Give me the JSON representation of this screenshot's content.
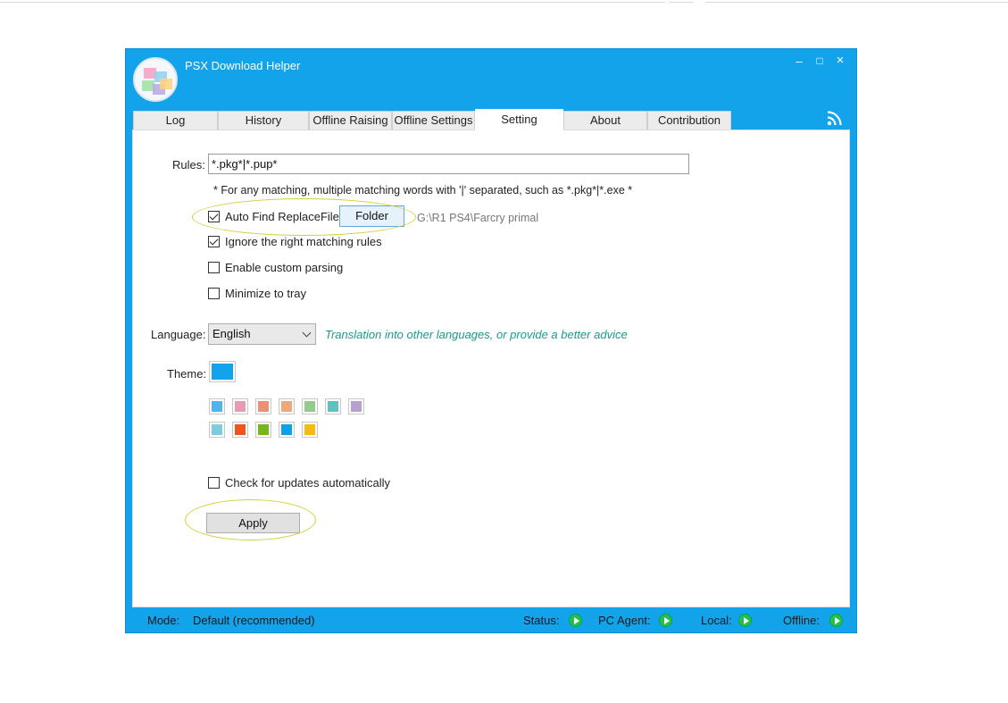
{
  "window": {
    "title": "PSX Download Helper",
    "accent_color": "#12a3eb",
    "controls": {
      "minimize": "–",
      "maximize": "□",
      "close": "×"
    }
  },
  "tabs": [
    {
      "label": "Log"
    },
    {
      "label": "History"
    },
    {
      "label": "Offline Raising"
    },
    {
      "label": "Offline Settings"
    },
    {
      "label": "Setting"
    },
    {
      "label": "About"
    },
    {
      "label": "Contribution"
    }
  ],
  "active_tab": "Setting",
  "icons": {
    "rss": "rss-icon",
    "logo": "app-logo"
  },
  "settings": {
    "rules_label": "Rules:",
    "rules_value": "*.pkg*|*.pup*",
    "rules_note": "* For any matching, multiple matching words with '|' separated, such as *.pkg*|*.exe *",
    "auto_find_label": "Auto Find ReplaceFile",
    "auto_find_checked": true,
    "folder_button": "Folder",
    "folder_path": "G:\\R1 PS4\\Farcry primal",
    "ignore_rules_label": "Ignore the right matching rules",
    "ignore_rules_checked": true,
    "custom_parsing_label": "Enable custom parsing",
    "custom_parsing_checked": false,
    "minimize_tray_label": "Minimize to tray",
    "minimize_tray_checked": false,
    "language_label": "Language:",
    "language_value": "English",
    "translation_link": "Translation into other languages, or provide a better advice",
    "theme_label": "Theme:",
    "theme_current": "#12a3eb",
    "theme_swatches": [
      [
        "#52b4ec",
        "#e89ab6",
        "#ec8f77",
        "#eea97a",
        "#93cb8e",
        "#5cc3bd",
        "#b6a0cf"
      ],
      [
        "#7fcbe0",
        "#f0541e",
        "#76b51c",
        "#10a0e8",
        "#f8b910"
      ]
    ],
    "check_updates_label": "Check for updates automatically",
    "check_updates_checked": false,
    "apply_button": "Apply"
  },
  "statusbar": {
    "mode_label": "Mode:",
    "mode_value": "Default (recommended)",
    "status_label": "Status:",
    "pc_agent_label": "PC Agent:",
    "local_label": "Local:",
    "offline_label": "Offline:"
  }
}
